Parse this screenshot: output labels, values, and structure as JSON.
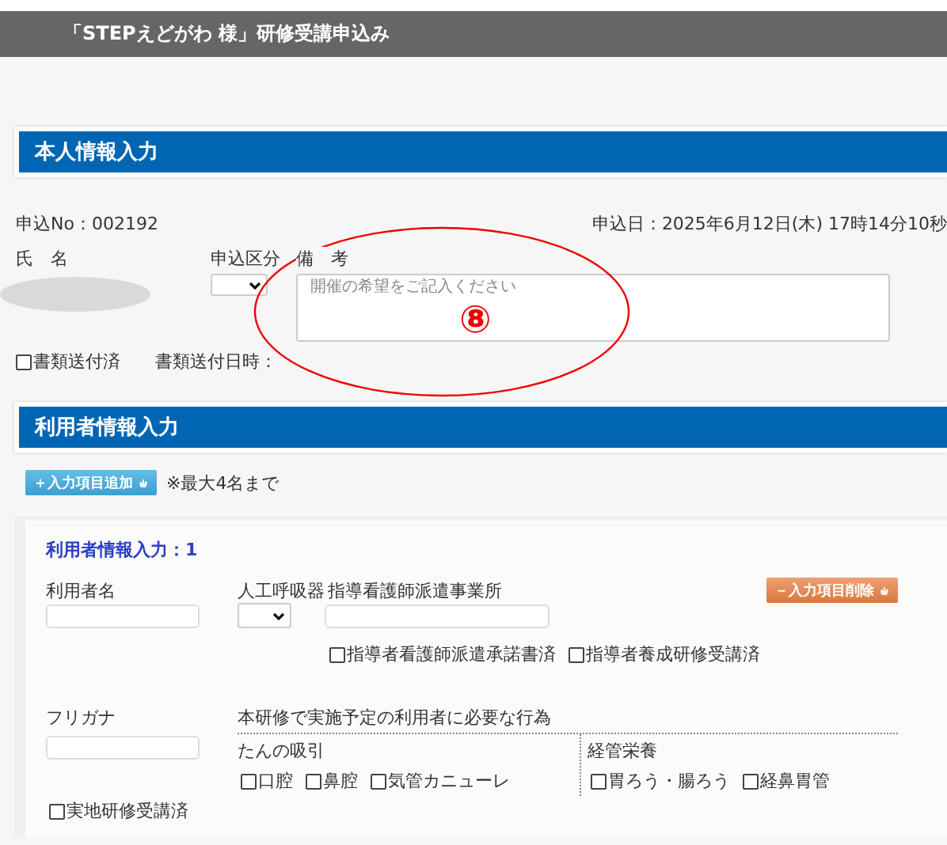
{
  "header": {
    "title": "「STEPえどがわ 様」研修受講申込み"
  },
  "personal": {
    "heading": "本人情報入力",
    "application_no": "申込No：002192",
    "application_date": "申込日：2025年6月12日(木) 17時14分10秒",
    "name_label": "氏　名",
    "category_label": "申込区分",
    "remarks_label": "備　考",
    "remarks_placeholder": "開催の希望をご記入ください",
    "documents_sent": {
      "label": "書類送付済",
      "checked": false
    },
    "documents_sent_date_label": "書類送付日時："
  },
  "annotation": {
    "text": "⑧"
  },
  "users": {
    "heading": "利用者情報入力",
    "add_button": "＋入力項目追加",
    "max_note": "※最大4名まで",
    "entries": [
      {
        "title": "利用者情報入力：1",
        "name_label": "利用者名",
        "ventilator_label": "人工呼吸器",
        "agency_label": "指導看護師派遣事業所",
        "delete_button": "－入力項目削除",
        "agency_checks": [
          {
            "label": "指導者看護師派遣承諾書済",
            "checked": false
          },
          {
            "label": "指導者養成研修受講済",
            "checked": false
          }
        ],
        "kana_label": "フリガナ",
        "acts_label": "本研修で実施予定の利用者に必要な行為",
        "act_groups": [
          {
            "label": "たんの吸引",
            "options": [
              {
                "label": "口腔",
                "checked": false
              },
              {
                "label": "鼻腔",
                "checked": false
              },
              {
                "label": "気管カニューレ",
                "checked": false
              }
            ]
          },
          {
            "label": "経管栄養",
            "options": [
              {
                "label": "胃ろう・腸ろう",
                "checked": false
              },
              {
                "label": "経鼻胃管",
                "checked": false
              }
            ]
          }
        ],
        "training_check": {
          "label": "実地研修受講済",
          "checked": false
        }
      }
    ]
  }
}
